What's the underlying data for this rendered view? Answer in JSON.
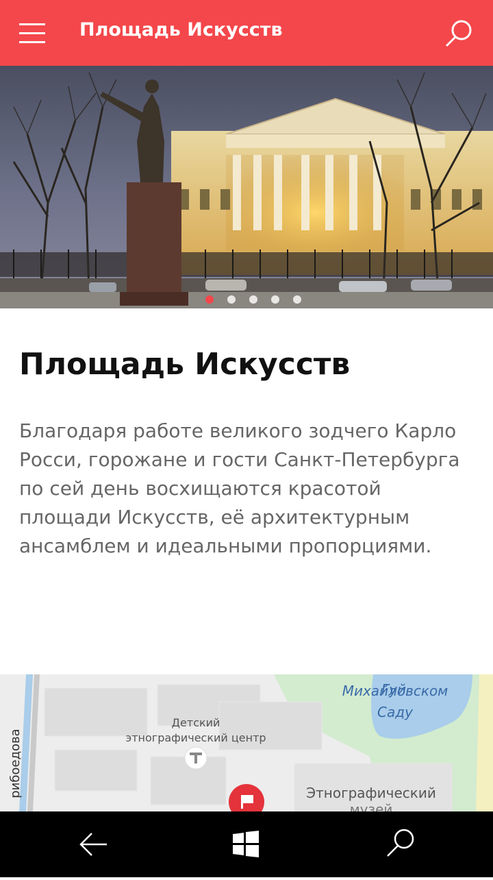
{
  "app_bar": {
    "title": "Площадь Искусств",
    "menu_icon": "hamburger-icon",
    "search_icon": "search-icon",
    "color": "#f4474b"
  },
  "carousel": {
    "slide_count": 5,
    "active_index": 0
  },
  "article": {
    "title": "Площадь Искусств",
    "description": "Благодаря работе великого зодчего Карло Росси, горожане и гости Санкт-Петербурга по сей день восхищаются красотой площади Искусств, её архитектурным ансамблем и идеальными пропорциями."
  },
  "map": {
    "labels": {
      "park_line1": "Михайловском",
      "park_line2": "Саду",
      "park_top_fragment": "Гуй",
      "center_line1": "Детский",
      "center_line2": "этнографический центр",
      "museum_line1": "Этнографический",
      "museum_line2": "музей",
      "street": "рибоедова"
    }
  },
  "system_nav": {
    "back_icon": "back-arrow-icon",
    "start_icon": "windows-logo-icon",
    "search_icon": "search-icon"
  }
}
